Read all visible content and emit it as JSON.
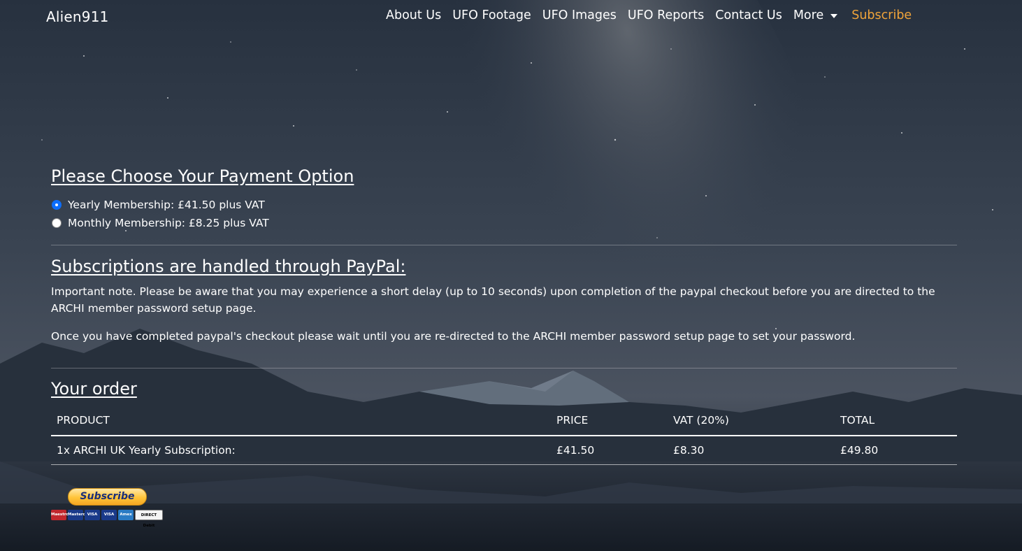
{
  "nav": {
    "brand": "Alien911",
    "links": [
      "About Us",
      "UFO Footage",
      "UFO Images",
      "UFO Reports",
      "Contact Us"
    ],
    "more_label": "More",
    "subscribe_label": "Subscribe"
  },
  "payment": {
    "heading": "Please Choose Your Payment Option",
    "options": [
      {
        "label": "Yearly Membership: £41.50 plus VAT",
        "checked": true
      },
      {
        "label": "Monthly Membership: £8.25 plus VAT",
        "checked": false
      }
    ]
  },
  "paypal_info": {
    "heading": "Subscriptions are handled through PayPal:",
    "note": "Important note. Please be aware that you may experience a short delay (up to 10 seconds) upon completion of the paypal checkout before you are directed to the ARCHI member password setup page.",
    "wait": "Once you have completed paypal's checkout please wait until you are re-directed to the ARCHI member password setup page to set your password."
  },
  "order": {
    "heading": "Your order",
    "columns": [
      "PRODUCT",
      "PRICE",
      "VAT (20%)",
      "TOTAL"
    ],
    "rows": [
      [
        "1x ARCHI UK Yearly Subscription:",
        "£41.50",
        "£8.30",
        "£49.80"
      ]
    ]
  },
  "paypal_button": {
    "label": "Subscribe",
    "cards": [
      "Maestro",
      "Mastercard",
      "VISA",
      "VISA",
      "Amex",
      "DIRECT Debit"
    ]
  },
  "colors": {
    "accent": "#f0a43a",
    "radio_checked": "#0d6efd"
  }
}
